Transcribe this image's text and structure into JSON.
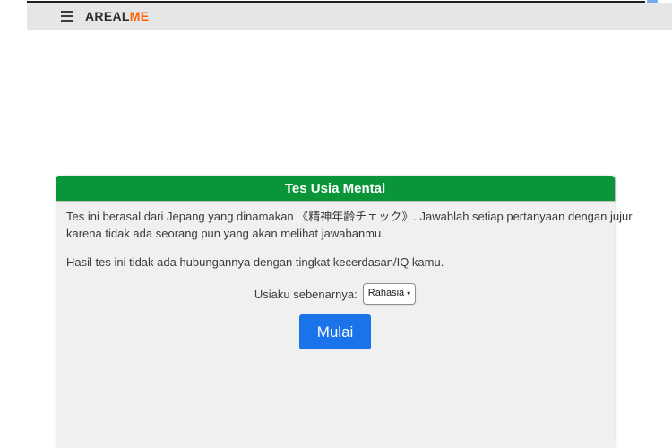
{
  "browser_chrome": {
    "accent_bar_color": "#7aa7f0"
  },
  "header": {
    "menu_icon": "hamburger-icon",
    "logo_part1": "AREAL",
    "logo_part2": "ME",
    "logo_accent_color": "#ff6000",
    "background_color": "#e6e6e6"
  },
  "card": {
    "title": "Tes Usia Mental",
    "title_bg_color": "#0a9638",
    "body_bg_color": "#f0f0f0",
    "intro_lines": [
      "Tes ini berasal dari Jepang yang dinamakan 《精神年齢チェック》. Jawablah setiap pertanyaan dengan jujur.",
      "karena tidak ada seorang pun yang akan melihat jawabanmu."
    ],
    "note": "Hasil tes ini tidak ada hubungannya dengan tingkat kecerdasan/IQ kamu.",
    "age_label": "Usiaku sebenarnya:",
    "age_select": {
      "selected": "Rahasia",
      "chevron_icon": "chevron-down-icon"
    },
    "start_button": {
      "label": "Mulai",
      "color": "#1a73e8"
    }
  }
}
